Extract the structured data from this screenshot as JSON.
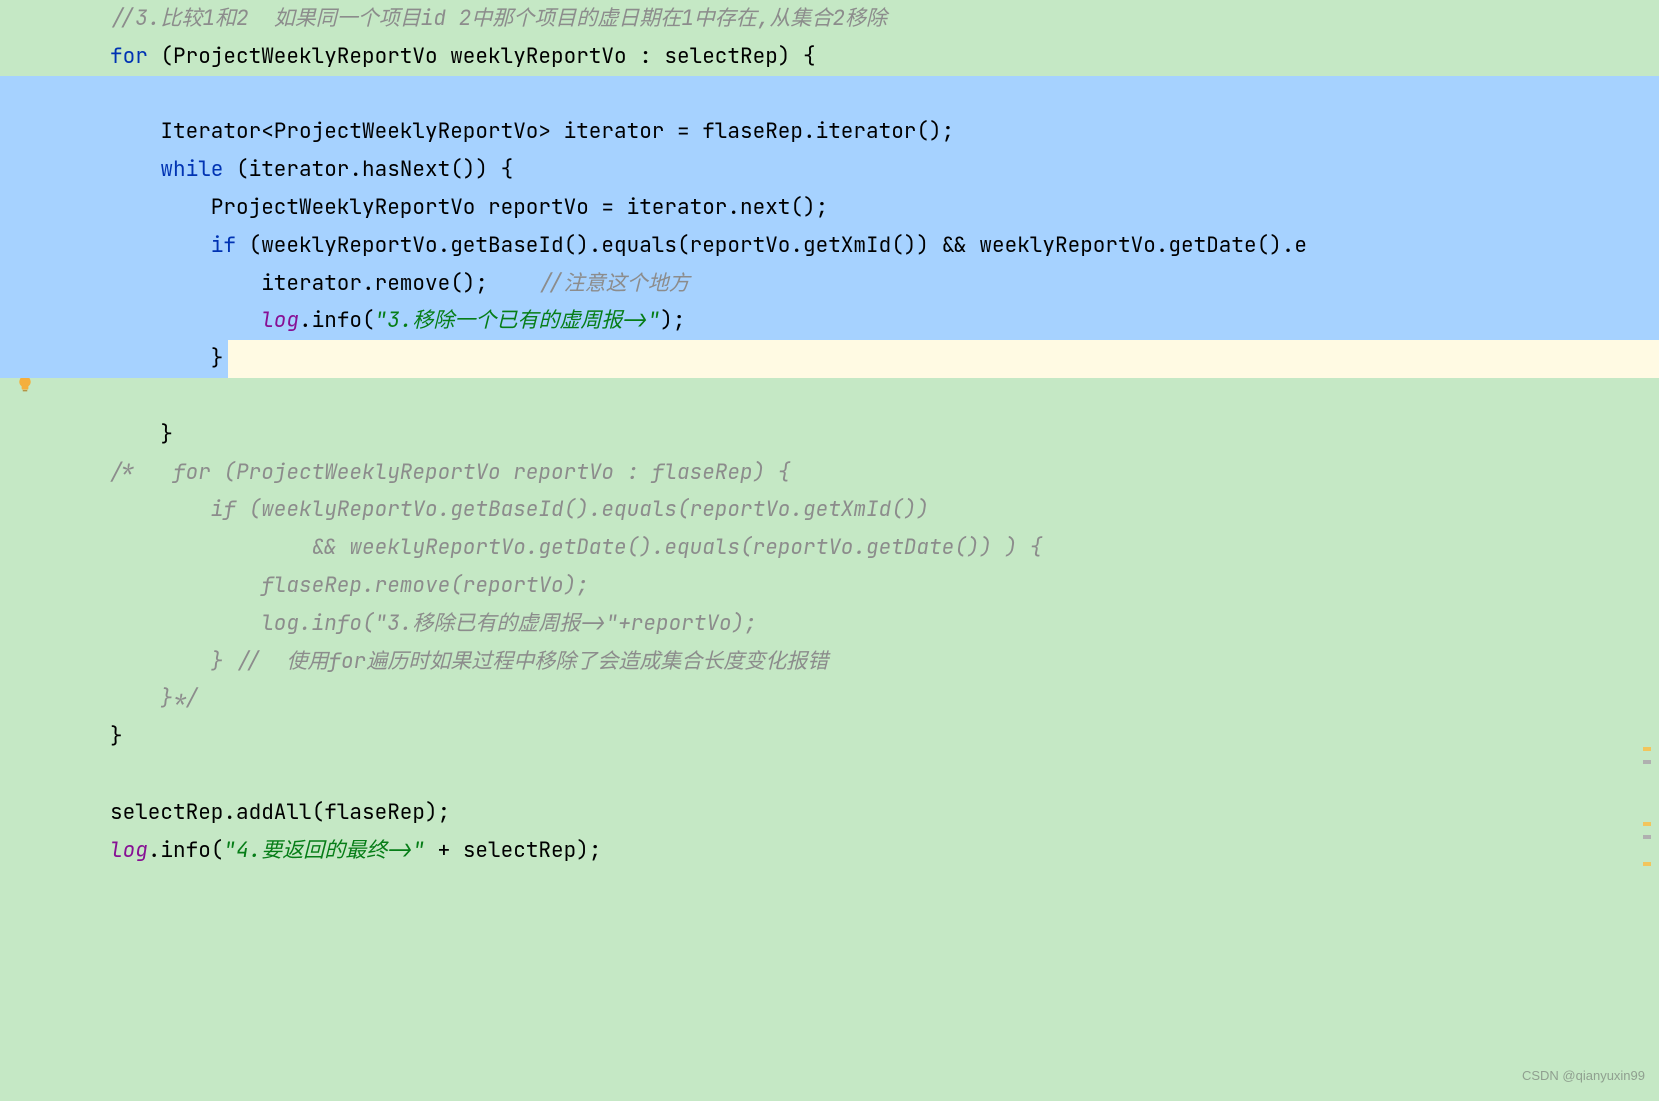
{
  "code": {
    "line1_comment": "//3.比较1和2  如果同一个项目id 2中那个项目的虚日期在1中存在,从集合2移除",
    "line2_for": "for",
    "line2_rest": " (ProjectWeeklyReportVo weeklyReportVo : selectRep) {",
    "line3": "",
    "line4": "    Iterator<ProjectWeeklyReportVo> iterator = flaseRep.iterator();",
    "line5_while": "    while",
    "line5_rest": " (iterator.hasNext()) {",
    "line6": "        ProjectWeeklyReportVo reportVo = iterator.next();",
    "line7_if": "        if",
    "line7_rest": " (weeklyReportVo.getBaseId().equals(reportVo.getXmId()) && weeklyReportVo.getDate().e",
    "line8_code": "            iterator.remove();    ",
    "line8_comment": "//注意这个地方",
    "line9_indent": "            ",
    "line9_log": "log",
    "line9_mid": ".info(",
    "line9_str": "\"3.移除一个已有的虚周报->\"",
    "line9_end": ");",
    "line10": "        }",
    "line11": "",
    "line12": "    }",
    "line13": "/*   for (ProjectWeeklyReportVo reportVo : flaseRep) {",
    "line14": "        if (weeklyReportVo.getBaseId().equals(reportVo.getXmId())",
    "line15": "                && weeklyReportVo.getDate().equals(reportVo.getDate()) ) {",
    "line16": "            flaseRep.remove(reportVo);",
    "line17": "            log.info(\"3.移除已有的虚周报->\"+reportVo);",
    "line18": "        } //  使用for遍历时如果过程中移除了会造成集合长度变化报错",
    "line19": "    }*/",
    "line20": "}",
    "line21": "",
    "line22": "selectRep.addAll(flaseRep);",
    "line23_log": "log",
    "line23_mid": ".info(",
    "line23_str": "\"4.要返回的最终->\"",
    "line23_end": " + selectRep);"
  },
  "watermark": "CSDN @qianyuxin99",
  "icons": {
    "bulb": "lightbulb-icon"
  }
}
